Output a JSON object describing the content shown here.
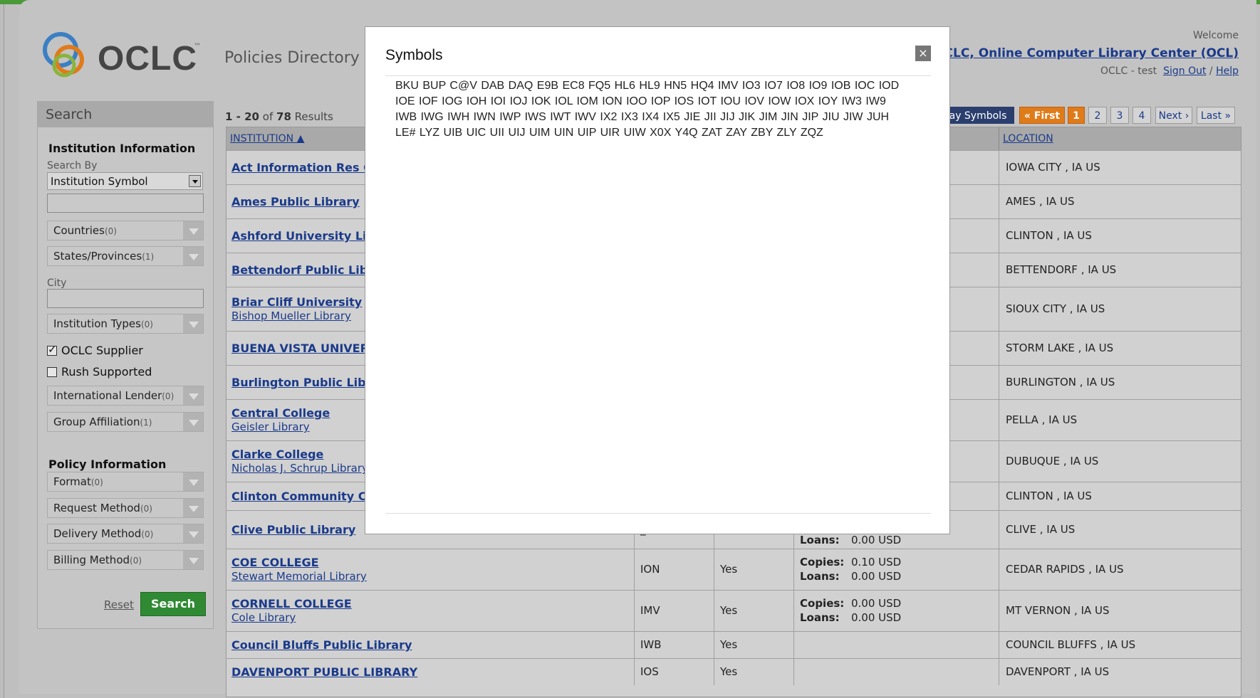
{
  "header": {
    "brand": "OCLC",
    "tm": "™",
    "title": "Policies Directory",
    "welcome": "Welcome",
    "org_link": "OCLC, Online Computer Library Center (OCL)",
    "user": "OCLC - test",
    "sign_out": "Sign Out",
    "separator": "/",
    "help": "Help"
  },
  "search": {
    "heading": "Search",
    "institution_info": "Institution Information",
    "search_by_label": "Search By",
    "search_by_value": "Institution Symbol",
    "countries": "Countries",
    "countries_count": "(0)",
    "states": "States/Provinces",
    "states_count": "(1)",
    "city_label": "City",
    "institution_types": "Institution Types",
    "institution_types_count": "(0)",
    "oclc_supplier": "OCLC Supplier",
    "rush_supported": "Rush Supported",
    "international_lender": "International Lender",
    "international_lender_count": "(0)",
    "group_affiliation": "Group Affiliation",
    "group_affiliation_count": "(1)",
    "policy_info": "Policy Information",
    "format": "Format",
    "format_count": "(0)",
    "request_method": "Request Method",
    "request_method_count": "(0)",
    "delivery_method": "Delivery Method",
    "delivery_method_count": "(0)",
    "billing_method": "Billing Method",
    "billing_method_count": "(0)",
    "reset": "Reset",
    "search_button": "Search"
  },
  "results": {
    "range": "1 - 20",
    "of": "of",
    "total": "78",
    "label": "Results",
    "col_institution": "INSTITUTION ▲",
    "col_location": "LOCATION"
  },
  "pager": {
    "display_symbols": "ay Symbols",
    "first": "« First",
    "pages": [
      "1",
      "2",
      "3",
      "4"
    ],
    "next": "Next ›",
    "last": "Last »"
  },
  "rows": [
    {
      "name": "Act Information Res Ce",
      "sub": "",
      "location": "IOWA CITY , IA US"
    },
    {
      "name": "Ames Public Library",
      "sub": "",
      "location": "AMES , IA US"
    },
    {
      "name": "Ashford University Libr",
      "sub": "",
      "location": "CLINTON , IA US"
    },
    {
      "name": "Bettendorf Public Libra",
      "sub": "",
      "location": "BETTENDORF , IA US"
    },
    {
      "name": "Briar Cliff University",
      "sub": "Bishop Mueller Library",
      "location": "SIOUX CITY , IA US"
    },
    {
      "name": "BUENA VISTA UNIVER",
      "sub": "",
      "location": "STORM LAKE , IA US"
    },
    {
      "name": "Burlington Public Libra",
      "sub": "",
      "location": "BURLINGTON , IA US"
    },
    {
      "name": "Central College",
      "sub": "Geisler Library",
      "location": "PELLA , IA US"
    },
    {
      "name": "Clarke College",
      "sub": "Nicholas J. Schrup Library",
      "location": "DUBUQUE , IA US"
    },
    {
      "name": "Clinton Community Coll",
      "sub": "",
      "location": "CLINTON , IA US"
    },
    {
      "name": "Clive Public Library",
      "sub": "",
      "symbol": "_",
      "loans_label": "Loans:",
      "loans": "0.00 USD",
      "location": "CLIVE , IA US"
    },
    {
      "name": "COE COLLEGE",
      "sub": "Stewart Memorial Library",
      "symbol": "ION",
      "supplier": "Yes",
      "copies_label": "Copies:",
      "copies": "0.10 USD",
      "loans_label": "Loans:",
      "loans": "0.00 USD",
      "location": "CEDAR RAPIDS , IA US"
    },
    {
      "name": "CORNELL COLLEGE",
      "sub": "Cole Library",
      "symbol": "IMV",
      "supplier": "Yes",
      "copies_label": "Copies:",
      "copies": "0.00 USD",
      "loans_label": "Loans:",
      "loans": "0.00 USD",
      "location": "MT VERNON , IA US"
    },
    {
      "name": "Council Bluffs Public Library",
      "sub": "",
      "symbol": "IWB",
      "supplier": "Yes",
      "location": "COUNCIL BLUFFS , IA US"
    },
    {
      "name": "DAVENPORT PUBLIC LIBRARY",
      "sub": "",
      "symbol": "IOS",
      "supplier": "Yes",
      "location": "DAVENPORT , IA US"
    }
  ],
  "modal": {
    "title": "Symbols",
    "close": "×",
    "text": "BKU BUP C@V DAB DAQ E9B EC8 FQ5 HL6 HL9 HN5 HQ4 IMV IO3 IO7 IO8 IO9 IOB IOC IOD IOE IOF IOG IOH IOI IOJ IOK IOL IOM ION IOO IOP IOS IOT IOU IOV IOW IOX IOY IW3 IW9 IWB IWG IWH IWN IWP IWS IWT IWV IX2 IX3 IX4 IX5 JIE JII JIJ JIK JIM JIN JIP JIU JIW JUH LE# LYZ UIB UIC UII UIJ UIM UIN UIP UIR UIW X0X Y4Q ZAT ZAY ZBY ZLY ZQZ"
  },
  "colors": {
    "accent_green": "#2f8a33",
    "link_blue": "#1a3a8a",
    "pager_orange": "#e07b1a",
    "dark_navy": "#2a3f6e"
  }
}
